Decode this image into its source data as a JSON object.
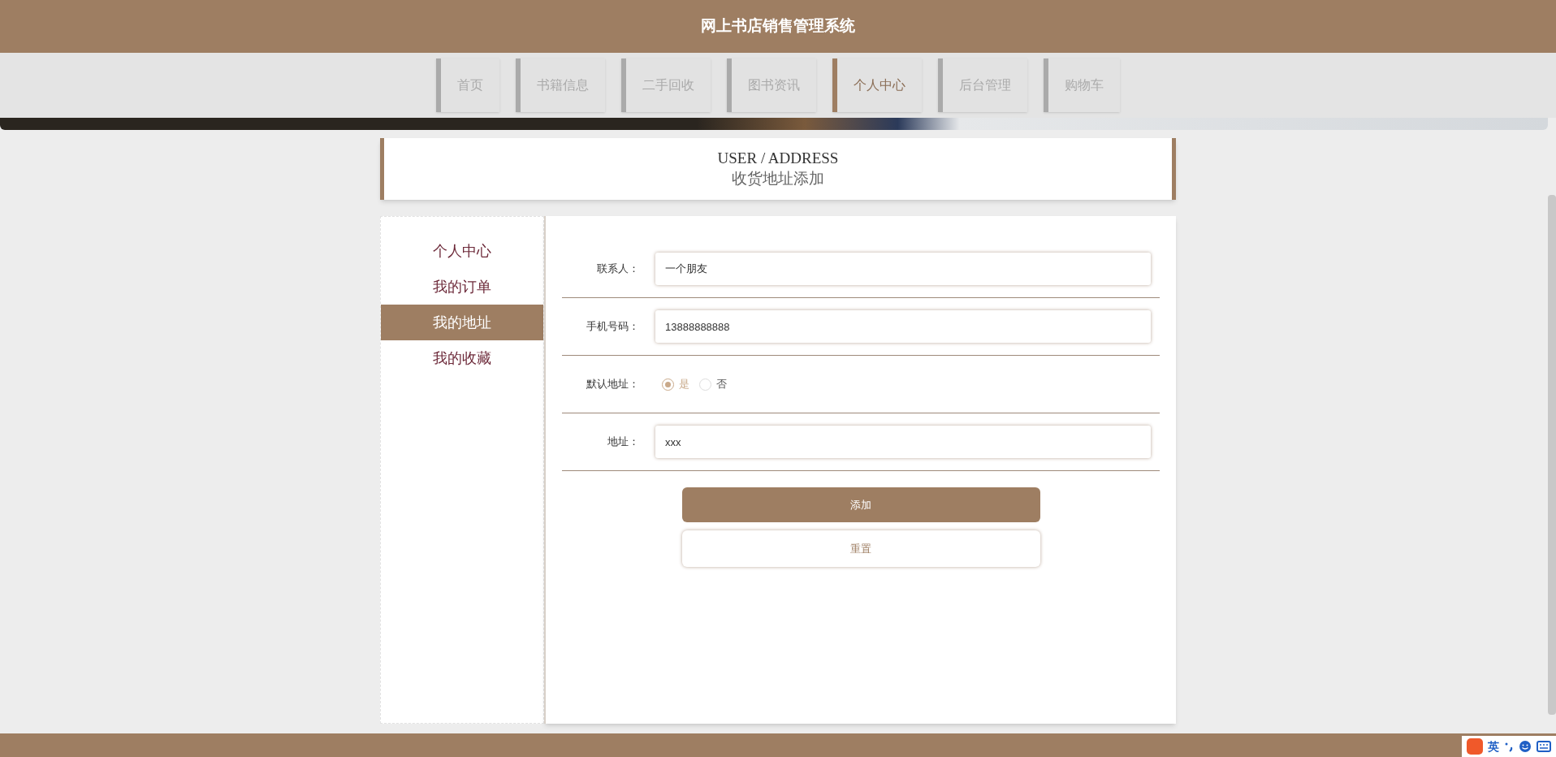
{
  "header": {
    "title": "网上书店销售管理系统"
  },
  "nav": [
    {
      "label": "首页",
      "selected": false
    },
    {
      "label": "书籍信息",
      "selected": false
    },
    {
      "label": "二手回收",
      "selected": false
    },
    {
      "label": "图书资讯",
      "selected": false
    },
    {
      "label": "个人中心",
      "selected": true
    },
    {
      "label": "后台管理",
      "selected": false
    },
    {
      "label": "购物车",
      "selected": false
    }
  ],
  "page_title": {
    "english": "USER / ADDRESS",
    "chinese": "收货地址添加"
  },
  "sidebar": [
    {
      "label": "个人中心",
      "selected": false
    },
    {
      "label": "我的订单",
      "selected": false
    },
    {
      "label": "我的地址",
      "selected": true
    },
    {
      "label": "我的收藏",
      "selected": false
    }
  ],
  "form": {
    "fields": [
      {
        "kind": "text",
        "label": "联系人：",
        "value": "一个朋友"
      },
      {
        "kind": "text",
        "label": "手机号码：",
        "value": "13888888888"
      },
      {
        "kind": "radio",
        "label": "默认地址：",
        "options": [
          {
            "label": "是",
            "selected": true
          },
          {
            "label": "否",
            "selected": false
          }
        ]
      },
      {
        "kind": "text",
        "label": "地址：",
        "value": "xxx"
      }
    ],
    "buttons": [
      {
        "kind": "primary",
        "label": "添加"
      },
      {
        "kind": "secondary",
        "label": "重置"
      }
    ]
  },
  "ime": {
    "mode": "英"
  }
}
